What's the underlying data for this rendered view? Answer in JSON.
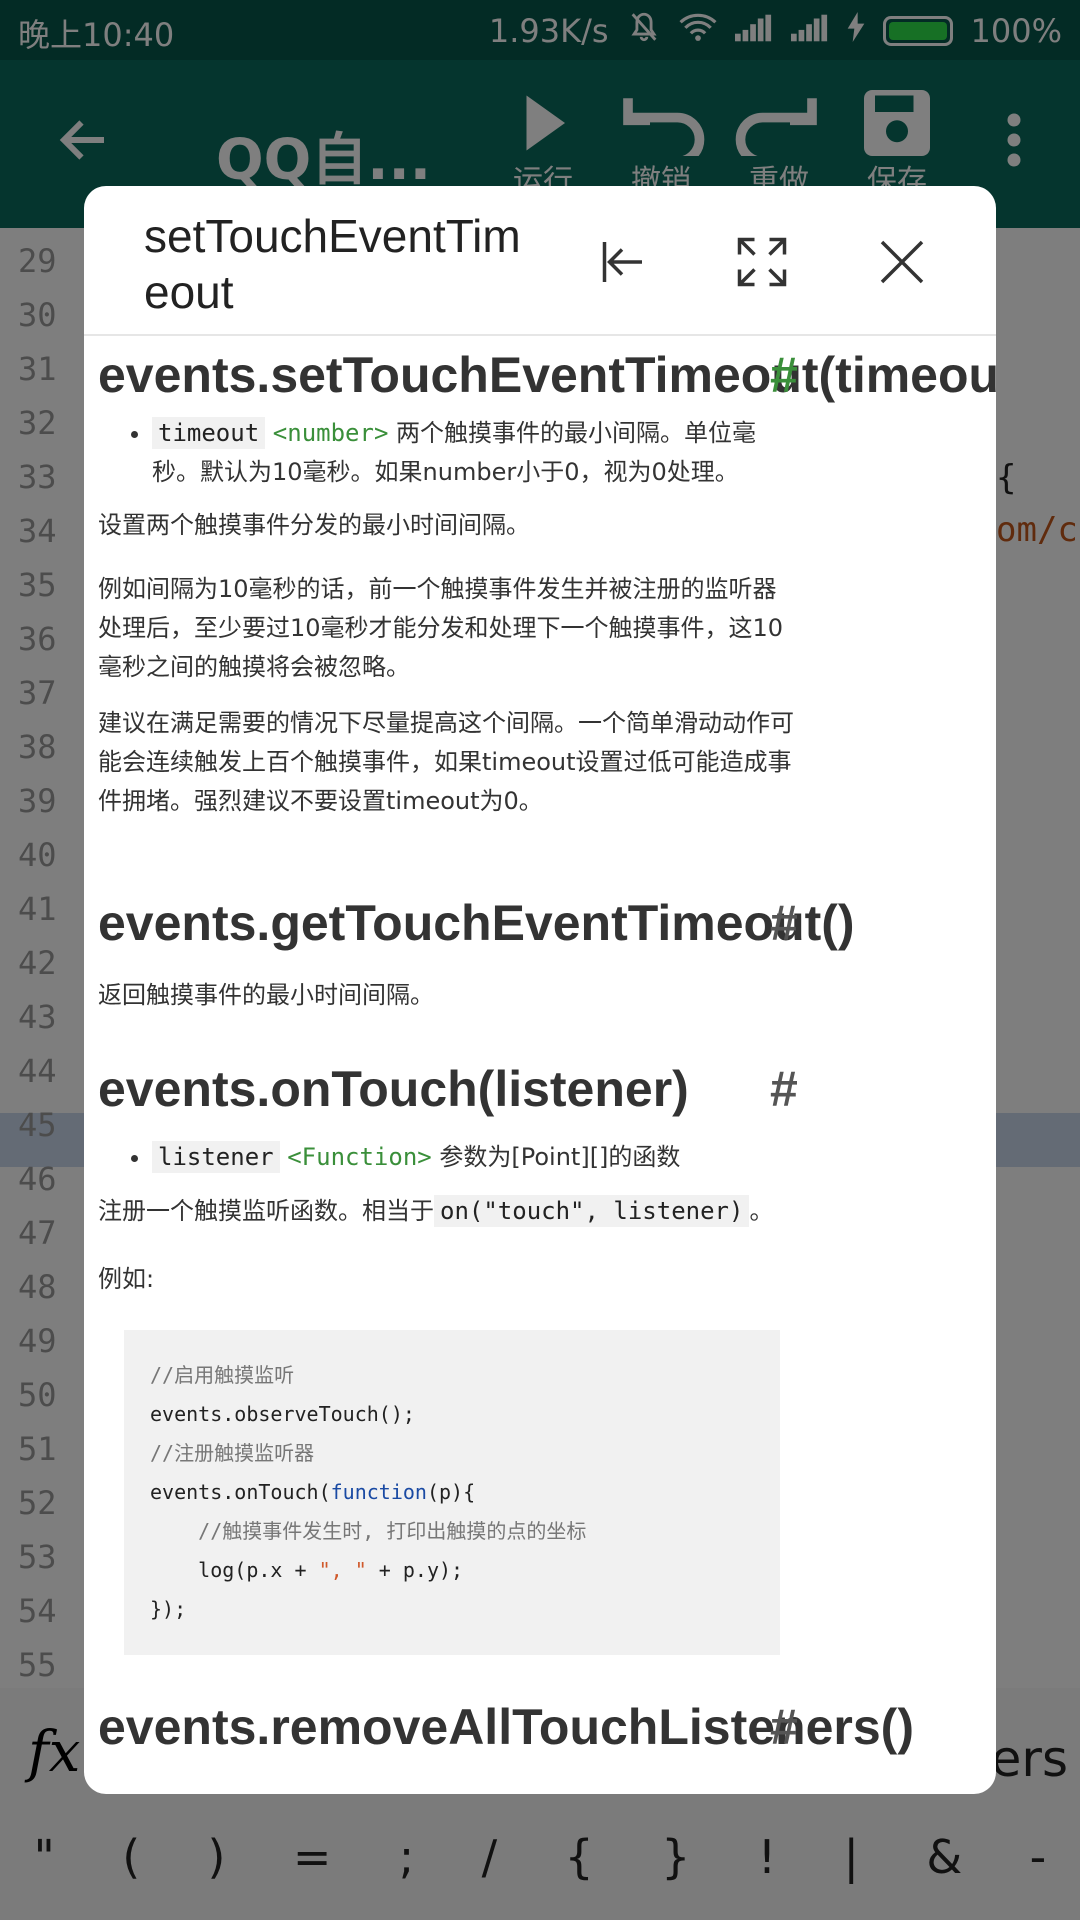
{
  "status_bar": {
    "time": "晚上10:40",
    "net_speed": "1.93K/s",
    "battery": "100%"
  },
  "toolbar": {
    "title": "QQ自...",
    "actions": [
      "运行",
      "撤销",
      "重做",
      "保存"
    ]
  },
  "editor": {
    "line_numbers": [
      "29",
      "30",
      "31",
      "32",
      "33",
      "34",
      "35",
      "36",
      "37",
      "38",
      "39",
      "40",
      "41",
      "42",
      "43",
      "44",
      "45",
      "46",
      "47",
      "48",
      "49",
      "50",
      "51",
      "52",
      "53",
      "54",
      "55"
    ],
    "fragment_brace": "{",
    "fragment_url": "om/c",
    "fragment_fx": "fx",
    "fragment_ners": "ners",
    "symbols": [
      "\"",
      "(",
      ")",
      "=",
      ";",
      "/",
      "{",
      "}",
      "!",
      "|",
      "&",
      "-"
    ]
  },
  "dialog": {
    "title": "setTouchEventTimeout",
    "sections": {
      "set_heading": "events.setTouchEventTimeout(timeout)",
      "set_param_name": "timeout",
      "set_param_type": "<number>",
      "set_param_desc": "两个触摸事件的最小间隔。单位毫秒。默认为10毫秒。如果number小于0，视为0处理。",
      "set_p1": "设置两个触摸事件分发的最小时间间隔。",
      "set_p2": "例如间隔为10毫秒的话，前一个触摸事件发生并被注册的监听器处理后，至少要过10毫秒才能分发和处理下一个触摸事件，这10毫秒之间的触摸将会被忽略。",
      "set_p3": "建议在满足需要的情况下尽量提高这个间隔。一个简单滑动动作可能会连续触发上百个触摸事件，如果timeout设置过低可能造成事件拥堵。强烈建议不要设置timeout为0。",
      "get_heading": "events.getTouchEventTimeout()",
      "get_p1": "返回触摸事件的最小时间间隔。",
      "on_heading": "events.onTouch(listener)",
      "on_param_name": "listener",
      "on_param_type": "<Function>",
      "on_param_desc": "参数为[Point][]的函数",
      "on_p1_prefix": "注册一个触摸监听函数。相当于",
      "on_p1_code": "on(\"touch\", listener)",
      "on_p1_suffix": "。",
      "on_example": "例如:",
      "code_c1": "//启用触摸监听",
      "code_l1": "events.observeTouch();",
      "code_c2": "//注册触摸监听器",
      "code_l2_a": "events.onTouch(",
      "code_l2_kw": "function",
      "code_l2_b": "(p){",
      "code_c3": "    //触摸事件发生时, 打印出触摸的点的坐标",
      "code_l3_a": "    log(p.x + ",
      "code_l3_str": "\", \"",
      "code_l3_b": " + p.y);",
      "code_l4": "});",
      "remove_heading": "events.removeAllTouchListeners()",
      "hash": "#"
    }
  }
}
